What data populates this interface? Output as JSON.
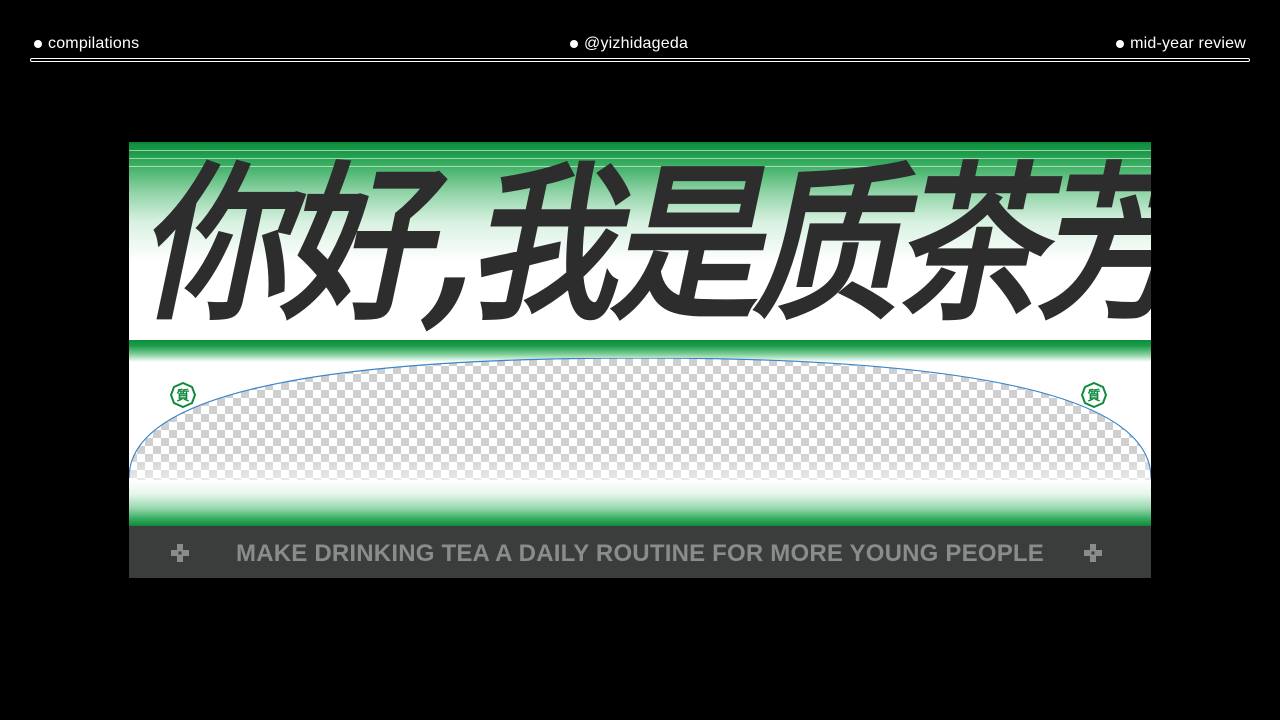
{
  "header": {
    "left_label": "compilations",
    "center_label": "@yizhidageda",
    "right_label": "mid-year review"
  },
  "banner": {
    "headline": "你好,我是质茶芳芳",
    "seal_glyph": "質",
    "tagline": "MAKE DRINKING TEA A DAILY ROUTINE FOR MORE YOUNG PEOPLE",
    "colors": {
      "green": "#0e8a3c",
      "headline": "#2d2d2d",
      "tagline_bar": "#3b3c3c",
      "tagline_text": "#8a8b8b",
      "arc_line": "#3a86c8"
    },
    "icons": [
      "seal-icon",
      "transparency-checker",
      "cross-icon"
    ]
  }
}
